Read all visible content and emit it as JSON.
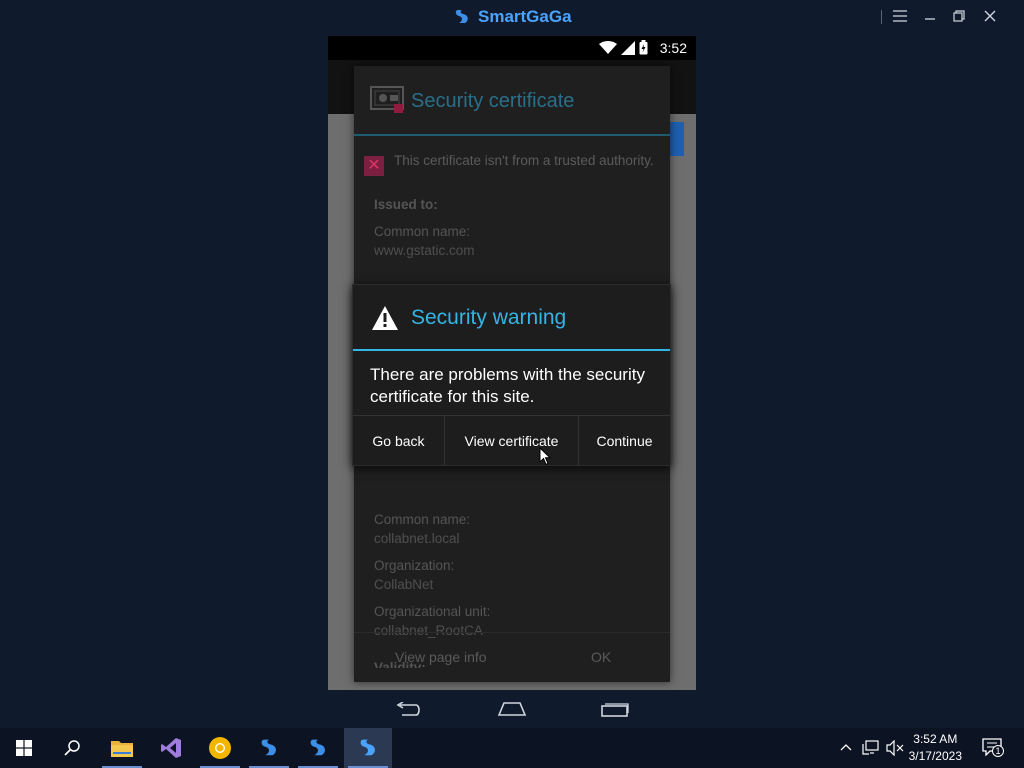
{
  "emulator": {
    "title": "SmartGaGa",
    "menu_icon": "hamburger-menu-icon",
    "minimize_icon": "minimize-icon",
    "restore_icon": "restore-icon",
    "close_icon": "close-icon"
  },
  "statusbar": {
    "time": "3:52",
    "icons": [
      "wifi-icon",
      "signal-icon",
      "battery-icon"
    ]
  },
  "cert_dialog": {
    "title": "Security certificate",
    "warning_text": "This certificate isn't from a trusted authority.",
    "issued_to_label": "Issued to:",
    "common_name_label": "Common name:",
    "common_name_value": "www.gstatic.com",
    "issued_by_common_name_label": "Common name:",
    "issued_by_common_name_value": "collabnet.local",
    "organization_label": "Organization:",
    "organization_value": "CollabNet",
    "org_unit_label": "Organizational unit:",
    "org_unit_value": "collabnet_RootCA",
    "validity_label": "Validity:",
    "view_page_info": "View page info",
    "ok": "OK"
  },
  "warning_dialog": {
    "title": "Security warning",
    "message": "There are problems with the security certificate for this site.",
    "buttons": {
      "go_back": "Go back",
      "view_certificate": "View certificate",
      "continue": "Continue"
    }
  },
  "phone_nav": {
    "back_icon": "back-icon",
    "home_icon": "home-icon",
    "recents_icon": "recents-icon"
  },
  "taskbar": {
    "time": "3:52 AM",
    "date": "3/17/2023",
    "notification_count": "1"
  },
  "colors": {
    "accent": "#33b5e5",
    "taskbar": "#0c1322",
    "brand": "#4aa3ff"
  }
}
